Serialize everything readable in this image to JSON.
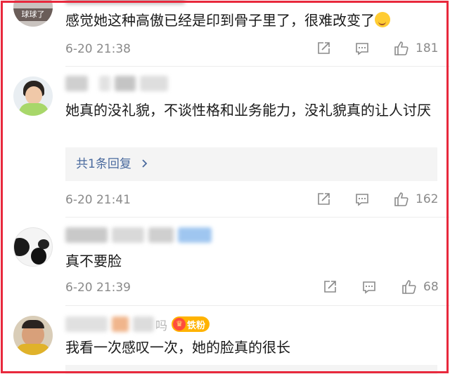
{
  "comments": [
    {
      "avatar_label": "球球了",
      "text": "感觉她这种高傲已经是印到骨子里了，很难改变了",
      "emoji": "drooling-face",
      "time": "6-20 21:38",
      "likes": "181"
    },
    {
      "text": "她真的没礼貌，不谈性格和业务能力，没礼貌真的让人讨厌",
      "reply_summary": "共1条回复",
      "time": "6-20 21:41",
      "likes": "162"
    },
    {
      "text": "真不要脸",
      "time": "6-20 21:39",
      "likes": "68"
    },
    {
      "name_suffix": "吗",
      "badge": "铁粉",
      "text": "我看一次感叹一次，她的脸真的很长"
    }
  ],
  "icons": {
    "share": "share-icon",
    "comment": "comment-icon",
    "like": "thumbs-up-icon",
    "reply_arrow": "chevron-right-icon",
    "badge": "crown-icon"
  },
  "colors": {
    "accent_border": "#e8283c",
    "link": "#4a6a9e",
    "badge": "#ffb300"
  }
}
